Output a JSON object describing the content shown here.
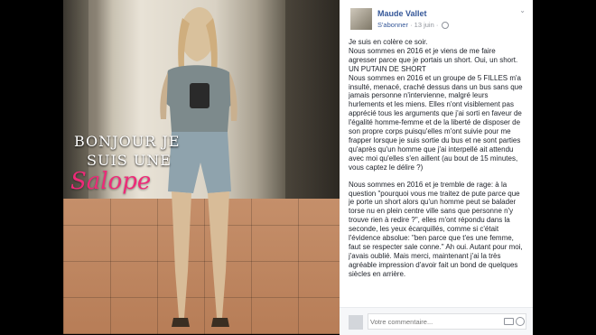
{
  "photo": {
    "overlay_line1": "BONJOUR JE",
    "overlay_line2": "SUIS UNE",
    "overlay_word": "Salope",
    "overlay_color": "#ee2a78"
  },
  "post": {
    "author": "Maude Vallet",
    "follow_label": "S'abonner",
    "date": "· 13 juin ·",
    "menu_icon": "chevron-down-icon",
    "paragraphs": [
      "Je suis en colère ce soir.",
      "Nous sommes en 2016 et je viens de me faire agresser parce que je portais un short. Oui, un short. UN PUTAIN DE SHORT",
      "Nous sommes en 2016 et un groupe de 5 FILLES m'a insulté, menacé, craché dessus dans un bus sans que jamais personne n'intervienne, malgré leurs hurlements et les miens. Elles n'ont visiblement pas apprécié tous les arguments que j'ai sorti en faveur de l'égalité homme-femme et de la liberté de disposer de son propre corps puisqu'elles m'ont suivie pour me frapper lorsque je suis sortie du bus et ne sont parties qu'après qu'un homme que j'ai interpellé ait attendu avec moi qu'elles s'en aillent (au bout de 15 minutes, vous captez le délire ?)",
      "Nous sommes en 2016 et je tremble de rage: à la question \"pourquoi vous me traitez de pute parce que je porte un short alors qu'un homme peut se balader torse nu en plein centre ville sans que personne n'y trouve rien à redire ?\", elles m'ont répondu dans la seconde, les yeux écarquillés, comme si c'était l'évidence absolue: \"ben parce que t'es une femme, faut se respecter sale conne.\" Ah oui. Autant pour moi, j'avais oublié. Mais merci, maintenant j'ai la très agréable impression d'avoir fait un bond de quelques siècles en arrière."
    ]
  },
  "comment": {
    "placeholder": "Votre commentaire...",
    "camera_icon": "camera-icon",
    "emoji_icon": "emoji-icon"
  }
}
